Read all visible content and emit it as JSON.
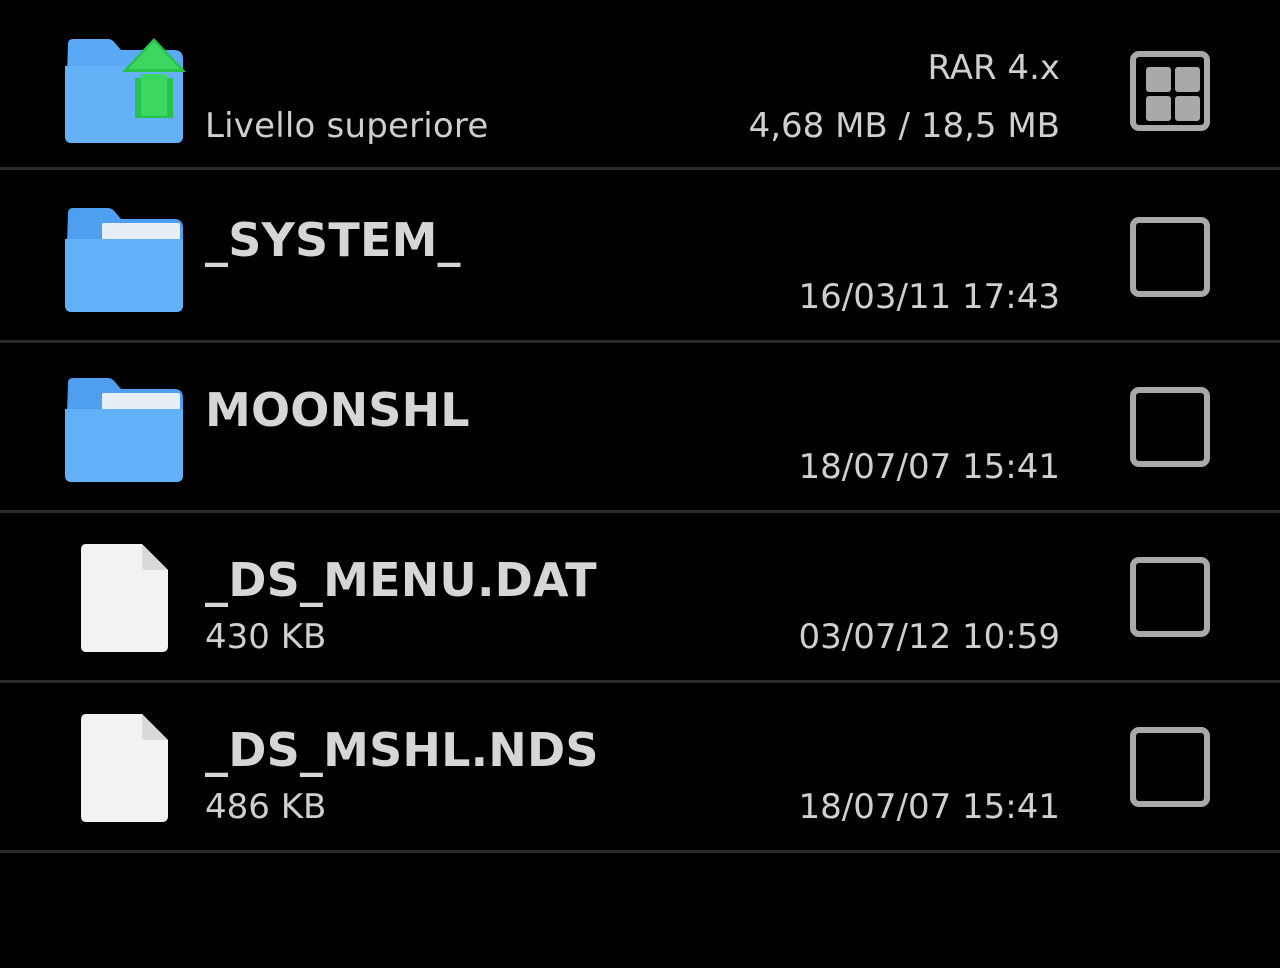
{
  "header_row": {
    "label": "Livello superiore",
    "archive_type": "RAR 4.x",
    "size_info": "4,68 MB / 18,5 MB",
    "icon": "folder-up-icon",
    "action_icon": "grid-view-icon"
  },
  "items": [
    {
      "name": "_SYSTEM_",
      "detail": "",
      "date": "16/03/11 17:43",
      "kind": "folder",
      "icon": "folder-icon"
    },
    {
      "name": "MOONSHL",
      "detail": "",
      "date": "18/07/07 15:41",
      "kind": "folder",
      "icon": "folder-icon"
    },
    {
      "name": "_DS_MENU.DAT",
      "detail": "430 KB",
      "date": "03/07/12 10:59",
      "kind": "file",
      "icon": "file-icon"
    },
    {
      "name": "_DS_MSHL.NDS",
      "detail": "486 KB",
      "date": "18/07/07 15:41",
      "kind": "file",
      "icon": "file-icon"
    }
  ],
  "colors": {
    "background": "#000000",
    "folder": "#5aa9f4",
    "up_arrow": "#2ecc55",
    "divider": "#2b2b2b",
    "checkbox": "#a9a9a9",
    "text": "#cfcfcf"
  }
}
